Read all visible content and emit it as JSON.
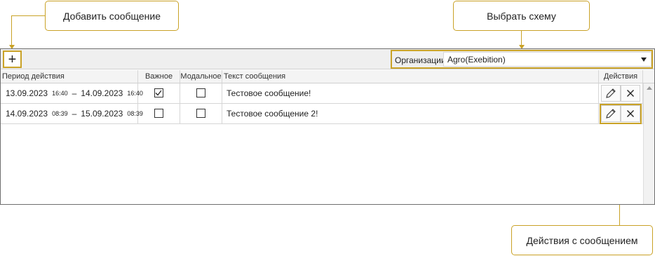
{
  "callouts": {
    "add_message": "Добавить сообщение",
    "choose_scheme": "Выбрать схему",
    "message_actions": "Действия с сообщением"
  },
  "toolbar": {
    "add_symbol": "+",
    "org_label": "Организации",
    "org_value": "Agro(Exebition)"
  },
  "table": {
    "headers": {
      "period": "Период действия",
      "important": "Важное",
      "modal": "Модальное",
      "text": "Текст сообщения",
      "actions": "Действия"
    },
    "rows": [
      {
        "start_date": "13.09.2023",
        "start_time": "16:40",
        "end_date": "14.09.2023",
        "end_time": "16:40",
        "important": true,
        "modal": false,
        "text": "Тестовое сообщение!"
      },
      {
        "start_date": "14.09.2023",
        "start_time": "08:39",
        "end_date": "15.09.2023",
        "end_time": "08:39",
        "important": false,
        "modal": false,
        "text": "Тестовое сообщение 2!"
      }
    ],
    "dash": "–"
  },
  "colors": {
    "accent": "#c9a227",
    "border": "#6f6f6f"
  },
  "icons": [
    "plus-icon",
    "caret-down-icon",
    "pencil-icon",
    "close-icon",
    "check-icon",
    "scroll-up-icon"
  ]
}
